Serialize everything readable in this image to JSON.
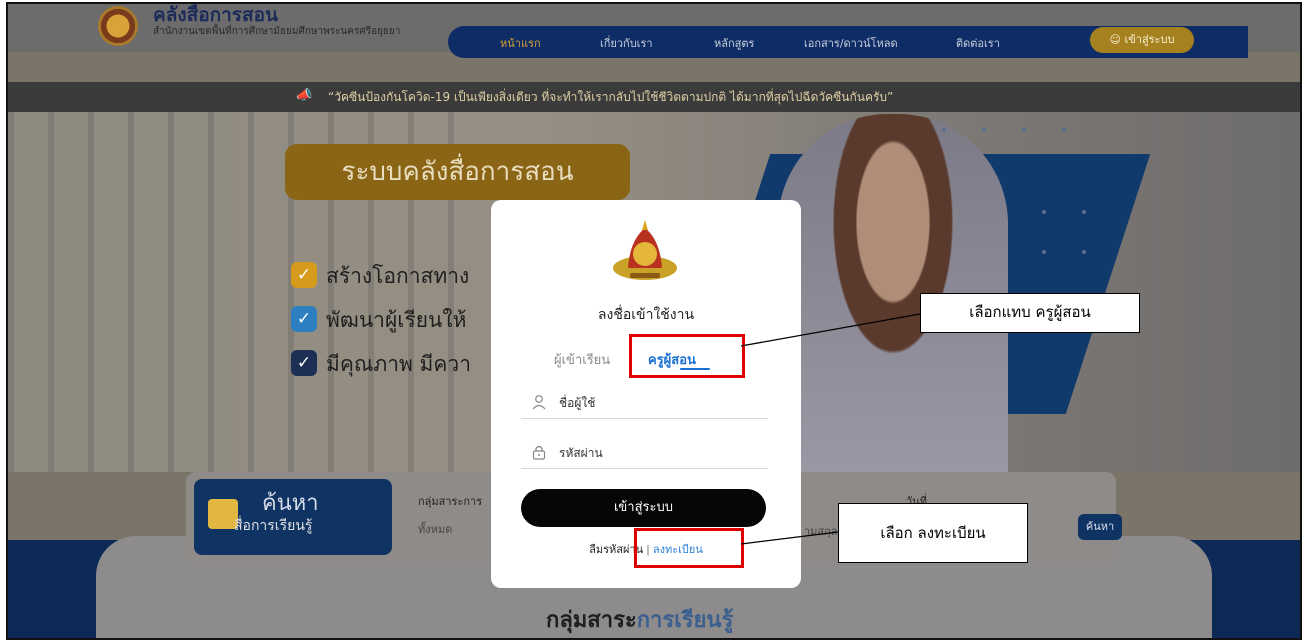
{
  "header": {
    "site_title": "คลังสื่อการสอน",
    "site_subtitle": "สำนักงานเขตพื้นที่การศึกษามัธยมศึกษาพระนครศรีอยุธยา",
    "nav": [
      "หน้าแรก",
      "เกี่ยวกับเรา",
      "หลักสูตร",
      "เอกสาร/ดาวน์โหลด",
      "ติดต่อเรา"
    ],
    "login_label": "เข้าสู่ระบบ"
  },
  "announcement": "“วัคซีนป้องกันโควิด-19 เป็นเพียงสิ่งเดียว ที่จะทำให้เรากลับไปใช้ชีวิตตามปกติ ได้มากที่สุดไปฉีดวัคซีนกันครับ”",
  "hero": {
    "title": "ระบบคลังสื่อการสอน",
    "bullets": [
      "สร้างโอกาสทาง",
      "พัฒนาผู้เรียนให้",
      "มีคุณภาพ มีควา"
    ]
  },
  "search": {
    "heading": "ค้นหา",
    "sub": "สื่อการเรียนรู้",
    "group_label": "กลุ่มสาระการ",
    "group_value": "ทั้งหมด",
    "date_label": "วันที่",
    "date_value": "ามสกุล",
    "button": "ค้นหา"
  },
  "section_title": {
    "part1": "กลุ่มสาระ",
    "part2": "การเรียนรู้"
  },
  "modal": {
    "title": "ลงชื่อเข้าใช้งาน",
    "tab_student": "ผู้เข้าเรียน",
    "tab_teacher": "ครูผู้สอน",
    "username_placeholder": "ชื่อผู้ใช้",
    "password_placeholder": "รหัสผ่าน",
    "login_button": "เข้าสู่ระบบ",
    "forgot": "ลืมรหัสผ่าน",
    "separator": "|",
    "register": "ลงทะเบียน"
  },
  "annotations": {
    "tab_note": "เลือกแทบ ครูผู้สอน",
    "register_note": "เลือก ลงทะเบียน"
  },
  "colors": {
    "accent_blue": "#1a6fd1",
    "navy": "#0f3463",
    "highlight_red": "#e00000",
    "gold": "#a6811f"
  }
}
